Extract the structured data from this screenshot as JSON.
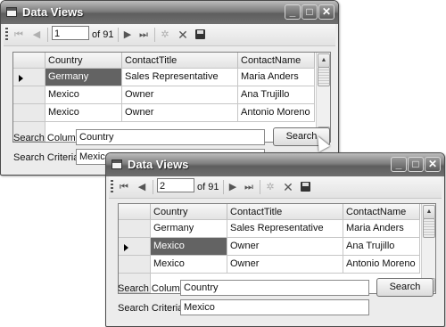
{
  "window1": {
    "title": "Data Views",
    "position_value": "1",
    "of_label": "of 91",
    "columns": [
      "Country",
      "ContactTitle",
      "ContactName"
    ],
    "rows": [
      [
        "Germany",
        "Sales Representative",
        "Maria Anders"
      ],
      [
        "Mexico",
        "Owner",
        "Ana Trujillo"
      ],
      [
        "Mexico",
        "Owner",
        "Antonio Moreno"
      ]
    ],
    "current_row": 0,
    "search_column_label": "Search Column:",
    "search_column_value": "Country",
    "search_criteria_label": "Search Criteria:",
    "search_criteria_value": "Mexico",
    "search_button": "Search"
  },
  "window2": {
    "title": "Data Views",
    "position_value": "2",
    "of_label": "of 91",
    "columns": [
      "Country",
      "ContactTitle",
      "ContactName"
    ],
    "rows": [
      [
        "Germany",
        "Sales Representative",
        "Maria Anders"
      ],
      [
        "Mexico",
        "Owner",
        "Ana Trujillo"
      ],
      [
        "Mexico",
        "Owner",
        "Antonio Moreno"
      ]
    ],
    "current_row": 1,
    "search_column_label": "Search Column:",
    "search_column_value": "Country",
    "search_criteria_label": "Search Criteria:",
    "search_criteria_value": "Mexico",
    "search_button": "Search"
  },
  "icons": {
    "app": "app-window-icon",
    "first": "move-first-icon",
    "prev": "move-previous-icon",
    "next": "move-next-icon",
    "last": "move-last-icon",
    "add": "add-new-icon",
    "delete": "delete-icon",
    "save": "save-icon",
    "minimize": "minimize-icon",
    "maximize": "maximize-icon",
    "close": "close-icon"
  }
}
